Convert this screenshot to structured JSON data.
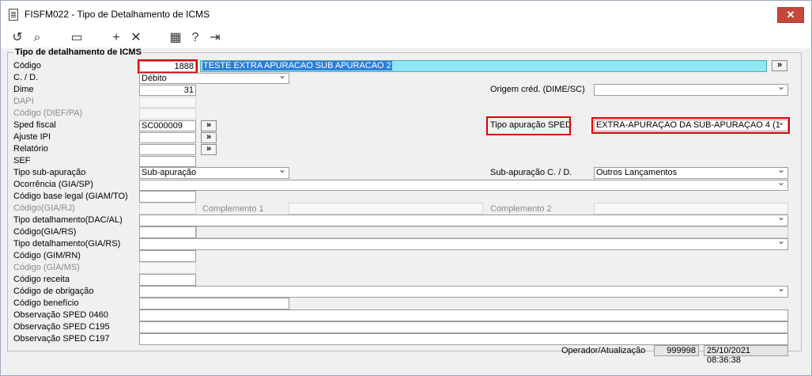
{
  "window": {
    "title": "FISFM022 - Tipo de Detalhamento de ICMS",
    "close": "✕"
  },
  "toolbar": {
    "undo": "↺",
    "search": "⌕",
    "save": "▭",
    "add": "+",
    "delete": "✕",
    "calendar": "▦",
    "help": "?",
    "exit": "⇥"
  },
  "section": {
    "title": "Tipo de detalhamento de ICMS"
  },
  "labels": {
    "codigo": "Código",
    "cd": "C. / D.",
    "dime": "Dime",
    "dapi": "DAPI",
    "codigo_dief": "Código (DIEF/PA)",
    "sped_fiscal": "Sped fiscal",
    "ajuste_ipi": "Ajuste IPI",
    "relatorio": "Relatório",
    "sef": "SEF",
    "tipo_sub": "Tipo sub-apuração",
    "ocorrencia": "Ocorrência (GIA/SP)",
    "codigo_base": "Código base legal (GIAM/TO)",
    "codigo_giarj": "Código(GIA/RJ)",
    "tipo_dac": "Tipo detalhamento(DAC/AL)",
    "codigo_giars": "Código(GIA/RS)",
    "tipo_giars": "Tipo detalhamento(GIA/RS)",
    "codigo_gimrn": "Código (GIM/RN)",
    "codigo_giams": "Código (GIA/MS)",
    "codigo_receita": "Código receita",
    "codigo_obrigacao": "Código de obrigação",
    "codigo_beneficio": "Código benefício",
    "obs_0460": "Observação SPED 0460",
    "obs_c195": "Observação SPED C195",
    "obs_c197": "Observação SPED C197",
    "origem": "Origem créd. (DIME/SC)",
    "tipo_apuracao": "Tipo apuração SPED",
    "sub_cd": "Sub-apuração C. / D.",
    "complemento1": "Complemento 1",
    "complemento2": "Complemento 2",
    "operador": "Operador/Atualização"
  },
  "values": {
    "codigo": "1888",
    "descricao": "TESTE EXTRA APURACAO SUB APURACAO 2",
    "cd": "Débito",
    "dime": "31",
    "sped_fiscal": "SC000009",
    "tipo_sub": "Sub-apuração",
    "tipo_apuracao": "EXTRA-APURAÇAO DA SUB-APURAÇAO 4 (1",
    "sub_cd": "Outros Lançamentos",
    "operador": "999998",
    "atualizacao": "25/10/2021 08:36:38"
  },
  "buttons": {
    "more": "»"
  }
}
